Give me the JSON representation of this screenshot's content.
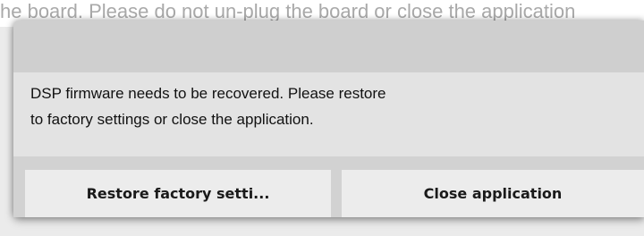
{
  "background": {
    "text": "he board. Please do not un-plug the board or close the application"
  },
  "dialog": {
    "message_line1": "DSP firmware needs to be recovered. Please restore",
    "message_line2": "to factory settings or close the application.",
    "buttons": {
      "restore_label": "Restore factory setti...",
      "close_label": "Close application"
    }
  },
  "colors": {
    "page_background": "#ebebeb",
    "dialog_background": "#d2d2d2",
    "message_area": "#e3e3e3",
    "button_background": "#ececec",
    "background_text": "#a9a9a9"
  }
}
